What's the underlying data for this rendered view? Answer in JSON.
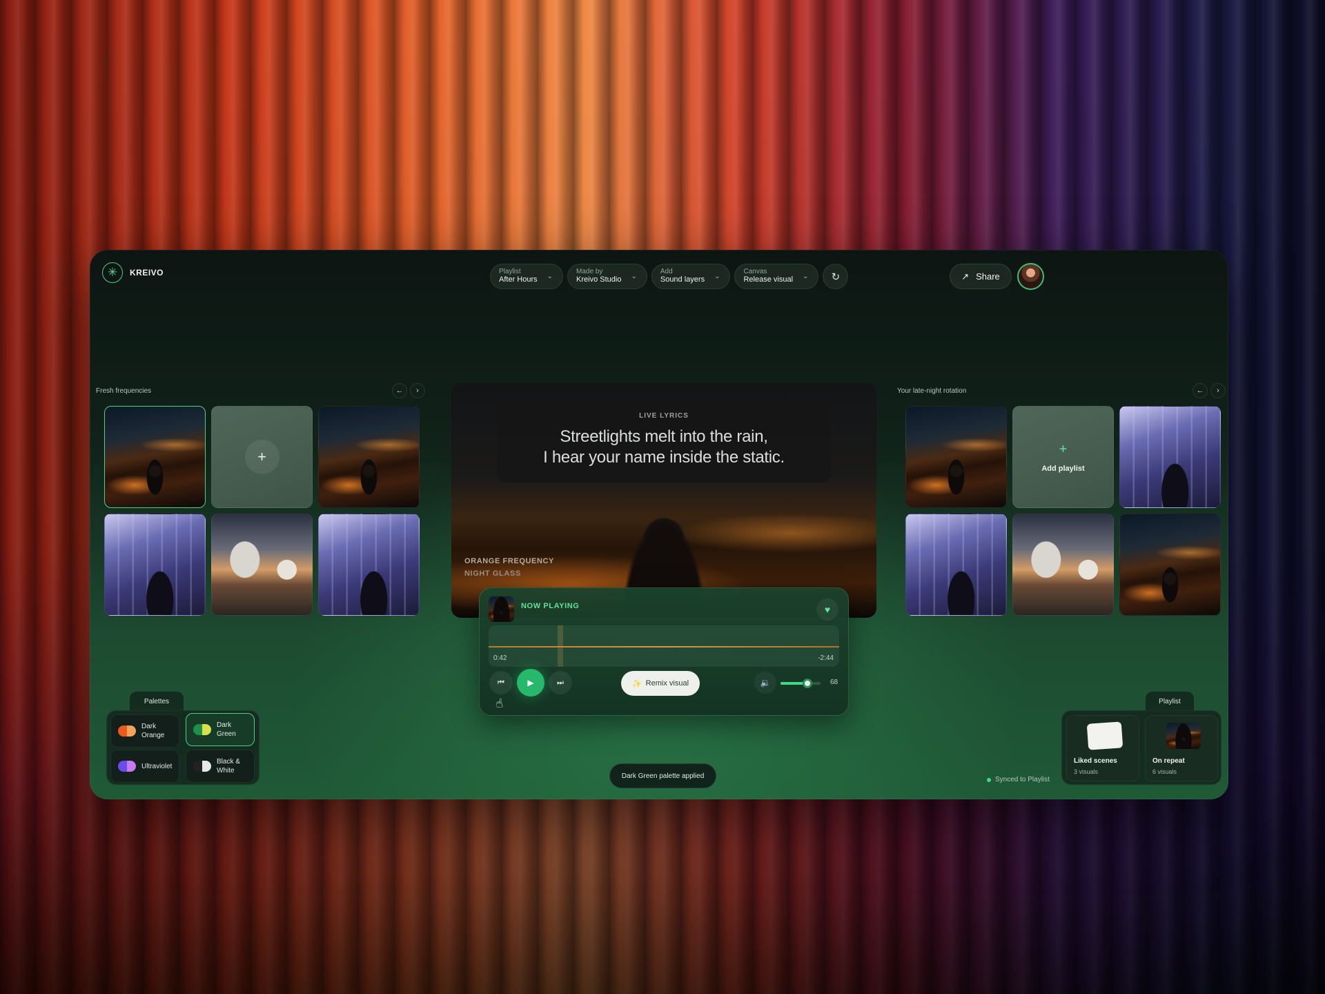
{
  "app": {
    "name": "KREIVO"
  },
  "topbar": {
    "pills": [
      {
        "key": "Playlist",
        "value": "After Hours"
      },
      {
        "key": "Made by",
        "value": "Kreivo Studio"
      },
      {
        "key": "Add",
        "value": "Sound layers"
      },
      {
        "key": "Canvas",
        "value": "Release visual"
      }
    ],
    "share_label": "Share"
  },
  "left": {
    "title": "Fresh frequencies",
    "tiles": [
      {
        "image": "night-street-figure",
        "selected": true
      },
      {
        "image": "add-tile"
      },
      {
        "image": "night-street-figure"
      },
      {
        "image": "tunnel-figure"
      },
      {
        "image": "desert-observatory"
      },
      {
        "image": "tunnel-figure"
      }
    ]
  },
  "right": {
    "title": "Your late-night rotation",
    "add_label": "Add playlist",
    "tiles": [
      {
        "image": "night-street-figure"
      },
      {
        "image": "add-tile"
      },
      {
        "image": "tunnel-figure"
      },
      {
        "image": "tunnel-figure"
      },
      {
        "image": "desert-observatory"
      },
      {
        "image": "night-street-figure"
      }
    ]
  },
  "stage": {
    "lyrics_label": "LIVE LYRICS",
    "lyrics_line1": "Streetlights melt into the rain,",
    "lyrics_line2": "I hear your name inside the static.",
    "caption_title": "ORANGE FREQUENCY",
    "caption_sub": "NIGHT GLASS"
  },
  "player": {
    "label": "NOW PLAYING",
    "time_current": "0:42",
    "time_remaining": "-2:44",
    "remix_label": "Remix visual",
    "volume": 68,
    "volume_label": "68"
  },
  "palettes": {
    "title": "Palettes",
    "items": [
      {
        "label": "Dark Orange",
        "colors": [
          "#e85a1e",
          "#f3a25a"
        ],
        "active": false
      },
      {
        "label": "Dark Green",
        "colors": [
          "#1e8f4a",
          "#d6e24a"
        ],
        "active": true
      },
      {
        "label": "Ultraviolet",
        "colors": [
          "#6a4de8",
          "#c97af0"
        ],
        "active": false
      },
      {
        "label": "Black & White",
        "colors": [
          "#222222",
          "#e8e8e8"
        ],
        "active": false
      }
    ]
  },
  "toast": "Dark Green palette applied",
  "sync_status": "Synced to Playlist",
  "playlist": {
    "title": "Playlist",
    "cards": [
      {
        "name": "Liked scenes",
        "count": "3 visuals"
      },
      {
        "name": "On repeat",
        "count": "6 visuals"
      }
    ]
  },
  "colors": {
    "accent": "#3fd884",
    "panel": "#12261c"
  }
}
